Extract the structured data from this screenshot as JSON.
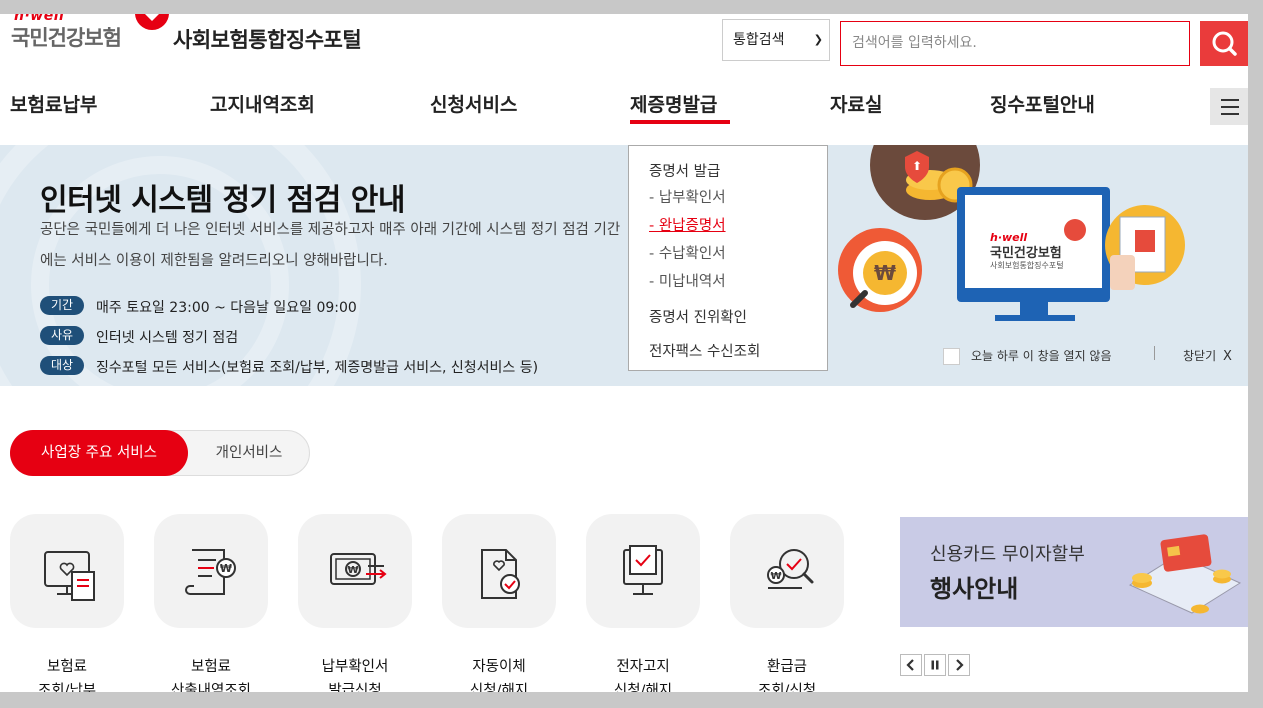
{
  "header": {
    "logo_small": "h·well",
    "logo_main": "국민건강보험",
    "site_title": "사회보험통합징수포털",
    "search_select": "통합검색",
    "search_placeholder": "검색어를 입력하세요."
  },
  "nav": {
    "items": [
      "보험료납부",
      "고지내역조회",
      "신청서비스",
      "제증명발급",
      "자료실",
      "징수포털안내"
    ]
  },
  "dropdown": {
    "group1": "증명서 발급",
    "subs": [
      "- 납부확인서",
      "- 완납증명서",
      "- 수납확인서",
      "- 미납내역서"
    ],
    "group2": "증명서 진위확인",
    "group3": "전자팩스 수신조회"
  },
  "banner": {
    "title": "인터넷 시스템 정기 점검 안내",
    "desc": "공단은 국민들에게 더 나은 인터넷 서비스를 제공하고자 매주 아래 기간에 시스템 정기 점검 기간에는 서비스 이용이 제한됨을 알려드리오니 양해바랍니다.",
    "rows": [
      {
        "badge": "기간",
        "text": "매주 토요일 23:00 ~ 다음날 일요일 09:00"
      },
      {
        "badge": "사유",
        "text": "인터넷 시스템 정기 점검"
      },
      {
        "badge": "대상",
        "text": "징수포털 모든 서비스(보험료 조회/납부, 제증명발급 서비스, 신청서비스 등)"
      }
    ],
    "checkbox_label": "오늘 하루 이 창을 열지 않음",
    "close_label": "창닫기",
    "close_x": "X",
    "illustration_logo_small": "h·well",
    "illustration_logo_main": "국민건강보험",
    "illustration_logo_sub": "사회보험통합징수포털"
  },
  "tabs": {
    "active": "사업장 주요 서비스",
    "inactive": "개인서비스"
  },
  "services": [
    {
      "line1": "보험료",
      "line2": "조회/납부",
      "icon": "monitor-heart-receipt-icon"
    },
    {
      "line1": "보험료",
      "line2": "산출내역조회",
      "icon": "scroll-won-icon"
    },
    {
      "line1": "납부확인서",
      "line2": "발급신청",
      "icon": "won-card-arrow-icon"
    },
    {
      "line1": "자동이체",
      "line2": "신청/해지",
      "icon": "document-check-icon"
    },
    {
      "line1": "전자고지",
      "line2": "신청/해지",
      "icon": "monitor-check-icon"
    },
    {
      "line1": "환급금",
      "line2": "조회/신청",
      "icon": "won-magnifier-icon"
    }
  ],
  "promo": {
    "line1": "신용카드 무이자할부",
    "line2": "행사안내"
  },
  "colors": {
    "brand_red": "#e60012",
    "banner_bg": "#dde8f0",
    "badge_navy": "#1f4f79",
    "promo_bg": "#c9cbe6"
  }
}
